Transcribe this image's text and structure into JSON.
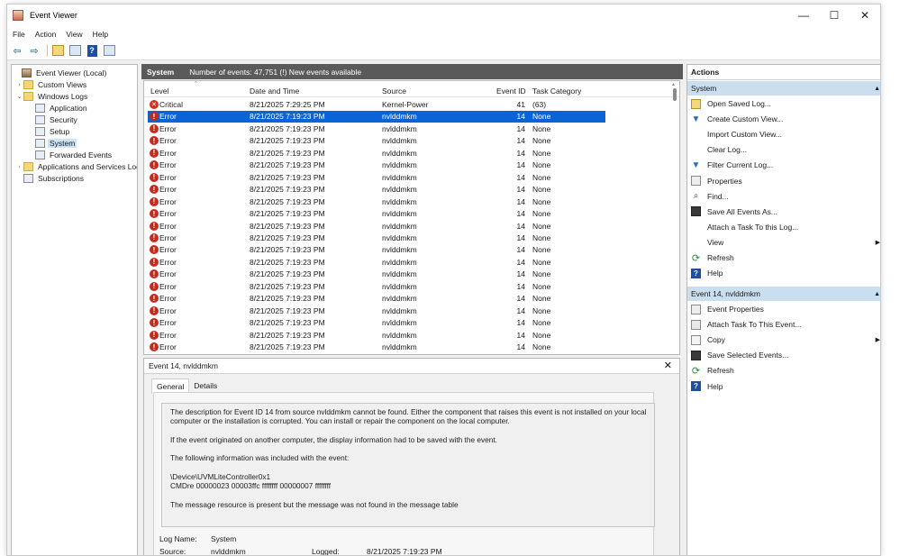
{
  "window": {
    "title": "Event Viewer",
    "minimize": "—",
    "maximize": "☐",
    "close": "✕"
  },
  "menu": [
    "File",
    "Action",
    "View",
    "Help"
  ],
  "tree": {
    "root": "Event Viewer (Local)",
    "custom_views": "Custom Views",
    "windows_logs": "Windows Logs",
    "logs": [
      "Application",
      "Security",
      "Setup",
      "System",
      "Forwarded Events"
    ],
    "selected_log": "System",
    "apps_services": "Applications and Services Log",
    "subscriptions": "Subscriptions"
  },
  "list": {
    "log_name": "System",
    "summary": "Number of events: 47,751 (!) New events available",
    "columns": [
      "Level",
      "Date and Time",
      "Source",
      "Event ID",
      "Task Category"
    ],
    "rows": [
      {
        "level": "Critical",
        "datetime": "8/21/2025 7:29:25 PM",
        "source": "Kernel-Power",
        "event_id": "41",
        "task": "(63)"
      },
      {
        "level": "Error",
        "datetime": "8/21/2025 7:19:23 PM",
        "source": "nvlddmkm",
        "event_id": "14",
        "task": "None"
      },
      {
        "level": "Error",
        "datetime": "8/21/2025 7:19:23 PM",
        "source": "nvlddmkm",
        "event_id": "14",
        "task": "None"
      },
      {
        "level": "Error",
        "datetime": "8/21/2025 7:19:23 PM",
        "source": "nvlddmkm",
        "event_id": "14",
        "task": "None"
      },
      {
        "level": "Error",
        "datetime": "8/21/2025 7:19:23 PM",
        "source": "nvlddmkm",
        "event_id": "14",
        "task": "None"
      },
      {
        "level": "Error",
        "datetime": "8/21/2025 7:19:23 PM",
        "source": "nvlddmkm",
        "event_id": "14",
        "task": "None"
      },
      {
        "level": "Error",
        "datetime": "8/21/2025 7:19:23 PM",
        "source": "nvlddmkm",
        "event_id": "14",
        "task": "None"
      },
      {
        "level": "Error",
        "datetime": "8/21/2025 7:19:23 PM",
        "source": "nvlddmkm",
        "event_id": "14",
        "task": "None"
      },
      {
        "level": "Error",
        "datetime": "8/21/2025 7:19:23 PM",
        "source": "nvlddmkm",
        "event_id": "14",
        "task": "None"
      },
      {
        "level": "Error",
        "datetime": "8/21/2025 7:19:23 PM",
        "source": "nvlddmkm",
        "event_id": "14",
        "task": "None"
      },
      {
        "level": "Error",
        "datetime": "8/21/2025 7:19:23 PM",
        "source": "nvlddmkm",
        "event_id": "14",
        "task": "None"
      },
      {
        "level": "Error",
        "datetime": "8/21/2025 7:19:23 PM",
        "source": "nvlddmkm",
        "event_id": "14",
        "task": "None"
      },
      {
        "level": "Error",
        "datetime": "8/21/2025 7:19:23 PM",
        "source": "nvlddmkm",
        "event_id": "14",
        "task": "None"
      },
      {
        "level": "Error",
        "datetime": "8/21/2025 7:19:23 PM",
        "source": "nvlddmkm",
        "event_id": "14",
        "task": "None"
      },
      {
        "level": "Error",
        "datetime": "8/21/2025 7:19:23 PM",
        "source": "nvlddmkm",
        "event_id": "14",
        "task": "None"
      },
      {
        "level": "Error",
        "datetime": "8/21/2025 7:19:23 PM",
        "source": "nvlddmkm",
        "event_id": "14",
        "task": "None"
      },
      {
        "level": "Error",
        "datetime": "8/21/2025 7:19:23 PM",
        "source": "nvlddmkm",
        "event_id": "14",
        "task": "None"
      },
      {
        "level": "Error",
        "datetime": "8/21/2025 7:19:23 PM",
        "source": "nvlddmkm",
        "event_id": "14",
        "task": "None"
      },
      {
        "level": "Error",
        "datetime": "8/21/2025 7:19:23 PM",
        "source": "nvlddmkm",
        "event_id": "14",
        "task": "None"
      },
      {
        "level": "Error",
        "datetime": "8/21/2025 7:19:23 PM",
        "source": "nvlddmkm",
        "event_id": "14",
        "task": "None"
      },
      {
        "level": "Error",
        "datetime": "8/21/2025 7:19:23 PM",
        "source": "nvlddmkm",
        "event_id": "14",
        "task": "None"
      }
    ],
    "selected_row": 1
  },
  "detail": {
    "title": "Event 14, nvlddmkm",
    "tabs": [
      "General",
      "Details"
    ],
    "description": [
      "The description for Event ID 14 from source nvlddmkm cannot be found. Either the component that raises this event is not installed on your local computer or the installation is corrupted. You can install or repair the component on the local computer.",
      "If the event originated on another computer, the display information had to be saved with the event.",
      "The following information was included with the event:",
      "\\Device\\UVMLiteController0x1",
      "CMDre 00000023 00003ffc ffffffff 00000007 ffffffff",
      "The message resource is present but the message was not found in the message table"
    ],
    "log_name_label": "Log Name:",
    "log_name_value": "System",
    "source_label": "Source:",
    "source_value": "nvlddmkm",
    "logged_label": "Logged:",
    "logged_value": "8/21/2025 7:19:23 PM"
  },
  "actions": {
    "title": "Actions",
    "system_section": "System",
    "system_items": [
      {
        "label": "Open Saved Log...",
        "icon": "open-log-icon"
      },
      {
        "label": "Create Custom View...",
        "icon": "filter-icon"
      },
      {
        "label": "Import Custom View...",
        "icon": ""
      },
      {
        "label": "Clear Log...",
        "icon": ""
      },
      {
        "label": "Filter Current Log...",
        "icon": "filter-icon"
      },
      {
        "label": "Properties",
        "icon": "properties-icon"
      },
      {
        "label": "Find...",
        "icon": "find-icon"
      },
      {
        "label": "Save All Events As...",
        "icon": "save-icon"
      },
      {
        "label": "Attach a Task To this Log...",
        "icon": ""
      },
      {
        "label": "View",
        "icon": "",
        "submenu": true
      },
      {
        "label": "Refresh",
        "icon": "refresh-icon"
      },
      {
        "label": "Help",
        "icon": "help-icon"
      }
    ],
    "event_section": "Event 14, nvlddmkm",
    "event_items": [
      {
        "label": "Event Properties",
        "icon": "properties-icon"
      },
      {
        "label": "Attach Task To This Event...",
        "icon": "attach-task-icon"
      },
      {
        "label": "Copy",
        "icon": "copy-icon",
        "submenu": true
      },
      {
        "label": "Save Selected Events...",
        "icon": "save-icon"
      },
      {
        "label": "Refresh",
        "icon": "refresh-icon"
      },
      {
        "label": "Help",
        "icon": "help-icon"
      }
    ]
  },
  "colors": {
    "selection": "#0a64d8",
    "section_header": "#c9dff0",
    "error_icon": "#c42b1c",
    "list_header": "#5a5a5a"
  }
}
